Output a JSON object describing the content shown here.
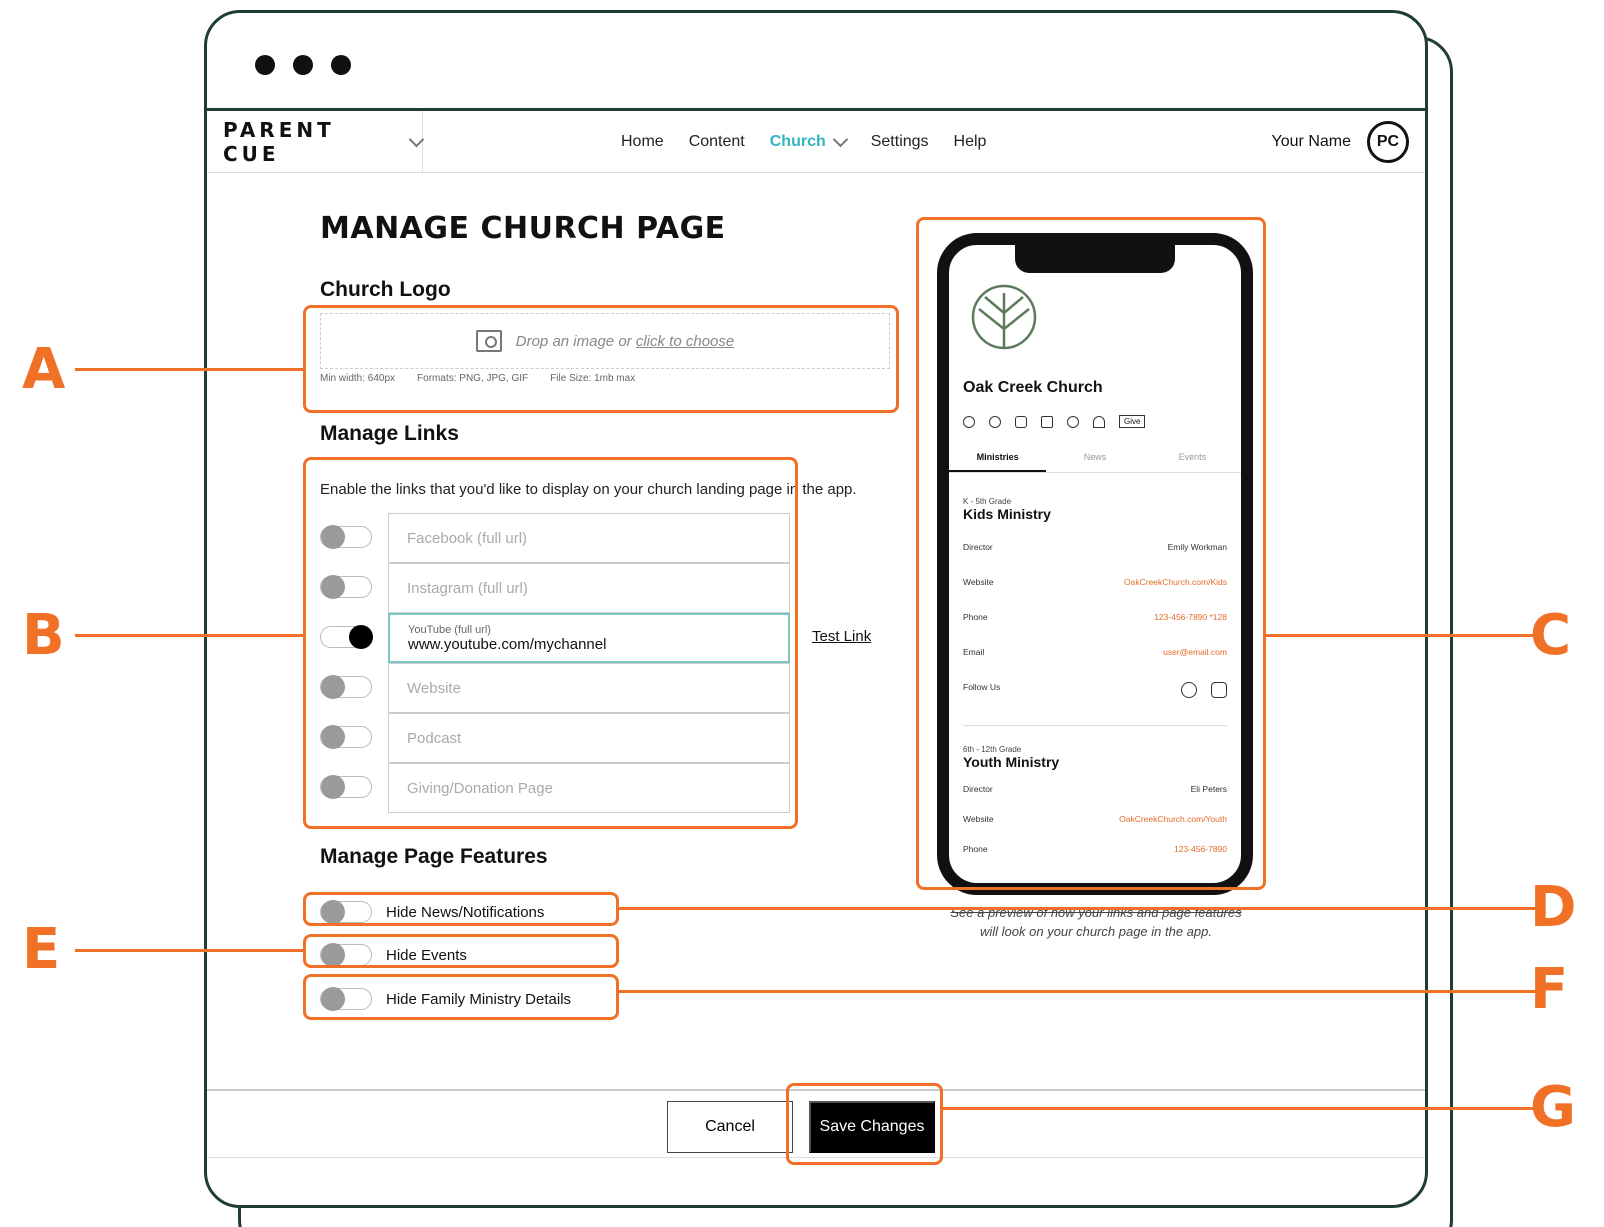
{
  "nav": {
    "brand": "PARENT CUE",
    "links": [
      "Home",
      "Content",
      "Church",
      "Settings",
      "Help"
    ],
    "active": "Church",
    "user_name": "Your Name",
    "avatar_initials": "PC"
  },
  "page": {
    "title": "MANAGE CHURCH PAGE",
    "logo_heading": "Church Logo",
    "dropzone_prefix": "Drop an image or",
    "dropzone_link": "click to choose",
    "hints": [
      "Min width: 640px",
      "Formats: PNG, JPG, GIF",
      "File Size: 1mb max"
    ],
    "links_heading": "Manage Links",
    "links_description": "Enable the links that you'd like to display on your church landing page in the app.",
    "links": [
      {
        "placeholder": "Facebook (full url)",
        "enabled": false
      },
      {
        "placeholder": "Instagram (full url)",
        "enabled": false
      },
      {
        "label": "YouTube (full url)",
        "value": "www.youtube.com/mychannel",
        "enabled": true
      },
      {
        "placeholder": "Website",
        "enabled": false
      },
      {
        "placeholder": "Podcast",
        "enabled": false
      },
      {
        "placeholder": "Giving/Donation Page",
        "enabled": false
      }
    ],
    "test_link": "Test Link",
    "features_heading": "Manage Page Features",
    "features": [
      "Hide News/Notifications",
      "Hide Events",
      "Hide Family Ministry Details"
    ]
  },
  "preview": {
    "church_name": "Oak Creek Church",
    "give": "Give",
    "tabs": [
      "Ministries",
      "News",
      "Events"
    ],
    "ministries": [
      {
        "grade": "K - 5th Grade",
        "name": "Kids Ministry",
        "rows": [
          {
            "label": "Director",
            "value": "Emily Workman"
          },
          {
            "label": "Website",
            "value": "OakCreekChurch.com/Kids"
          },
          {
            "label": "Phone",
            "value": "123-456-7890 *128"
          },
          {
            "label": "Email",
            "value": "user@email.com"
          },
          {
            "label": "Follow Us",
            "value": ""
          }
        ]
      },
      {
        "grade": "6th - 12th Grade",
        "name": "Youth Ministry",
        "rows": [
          {
            "label": "Director",
            "value": "Eli Peters"
          },
          {
            "label": "Website",
            "value": "OakCreekChurch.com/Youth"
          },
          {
            "label": "Phone",
            "value": "123-456-7890"
          }
        ]
      }
    ],
    "caption_1": "See a preview of how your links and page features",
    "caption_2": "will look on your church page in the app."
  },
  "footer": {
    "cancel": "Cancel",
    "save": "Save Changes"
  },
  "callouts": [
    "A",
    "B",
    "C",
    "D",
    "E",
    "F",
    "G"
  ],
  "colors": {
    "accent": "#2fb4c0",
    "callout": "#f07026",
    "window_border": "#1f3d33",
    "link_orange": "#e46b2c"
  }
}
